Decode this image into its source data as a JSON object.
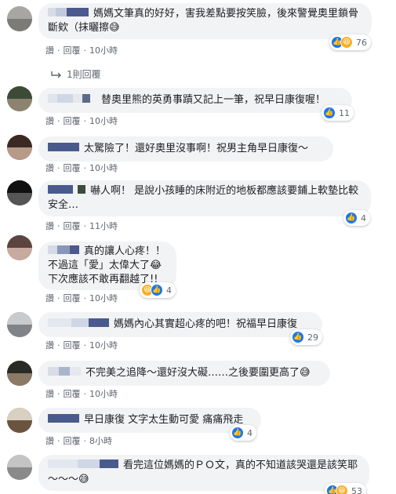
{
  "comments": [
    {
      "text": "媽媽文筆真的好好，害我差點要按笑臉，後來警覺奧里鎖骨斷欸（抹曬擦",
      "reaction_count": "76",
      "actions": [
        "讚",
        "回覆",
        "10小時"
      ]
    },
    {
      "text": "替奧里熊的英勇事蹟又記上一筆，祝早日康復喔！",
      "reaction_count": "11",
      "actions": [
        "讚",
        "回覆",
        "10小時"
      ]
    },
    {
      "text": "太驚險了！還好奧里沒事啊！祝男主角早日康復～",
      "reaction_count": "",
      "actions": [
        "讚",
        "回覆",
        "10小時"
      ]
    },
    {
      "text": "嚇人啊！ 是說小孩睡的床附近的地板都應該要鋪上軟墊比較安全…",
      "reaction_count": "4",
      "actions": [
        "讚",
        "回覆",
        "11小時"
      ]
    },
    {
      "text": "真的讓人心疼！！\n不過這「愛」太偉大了😂\n下次應該不敢再翻越了!!",
      "reaction_count": "4",
      "actions": [
        "讚",
        "回覆",
        "10小時"
      ]
    },
    {
      "text": "媽媽內心其實超心疼的吧！祝福早日康復",
      "reaction_count": "29",
      "actions": [
        "讚",
        "回覆",
        "10小時"
      ]
    },
    {
      "text": "不完美之追降～還好沒大礙……之後要圍更高了😅",
      "reaction_count": "",
      "actions": [
        "讚",
        "回覆",
        "10小時"
      ]
    },
    {
      "text": "早日康復 文字太生動可愛 痛痛飛走",
      "reaction_count": "4",
      "actions": [
        "讚",
        "回覆",
        "8小時"
      ]
    },
    {
      "text": "看完這位媽媽的ＰＯ文，真的不知道該哭還是該笑耶～～～😅",
      "reaction_count": "53",
      "actions": [
        "",
        "",
        ""
      ]
    }
  ],
  "replies_link": "1則回覆",
  "colors": {
    "like": "#1877f2",
    "haha": "#f7b125",
    "bubble": "#f2f3f5"
  }
}
